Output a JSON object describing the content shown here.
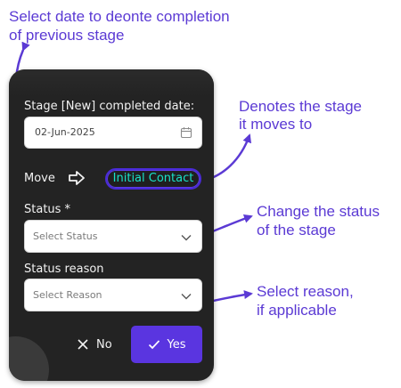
{
  "annotations": {
    "select_date_line1": "Select date to deonte completion",
    "select_date_line2": "of previous stage",
    "denotes_stage_line1": "Denotes the stage",
    "denotes_stage_line2": "it moves to",
    "change_status_line1": "Change the status",
    "change_status_line2": "of the stage",
    "select_reason_line1": "Select reason,",
    "select_reason_line2": "if applicable",
    "color": "#5b3ad4"
  },
  "dialog": {
    "completed_date_label": "Stage [New] completed date:",
    "completed_date_value": "02-Jun-2025",
    "calendar_icon": "calendar-icon",
    "move_label": "Move",
    "move_arrow_icon": "arrow-right-icon",
    "target_stage": "Initial Contact",
    "status_label": "Status *",
    "status_placeholder": "Select Status",
    "status_reason_label": "Status reason",
    "reason_placeholder": "Select Reason",
    "no_label": "No",
    "yes_label": "Yes",
    "accent_color": "#5a35e0",
    "stage_text_color": "#19e2c8",
    "background_color": "#232323"
  }
}
